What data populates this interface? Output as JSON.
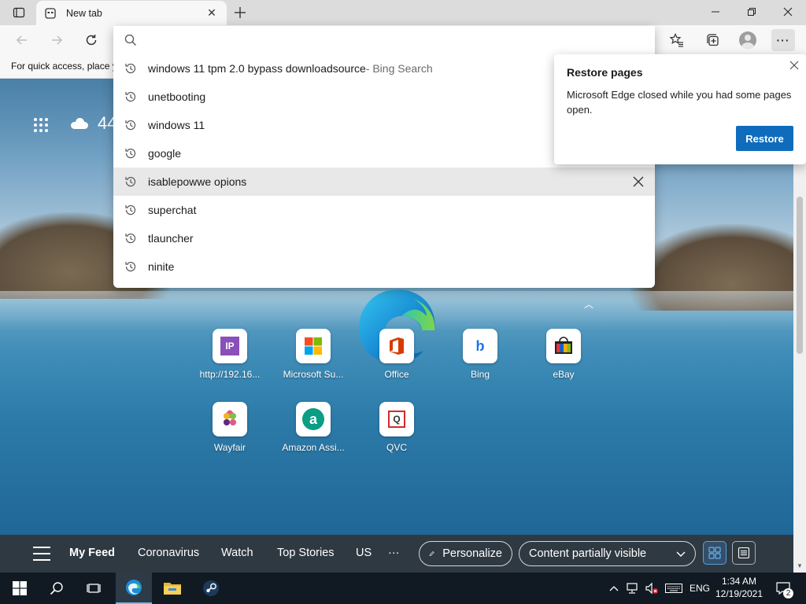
{
  "tab": {
    "title": "New tab"
  },
  "toolbar": {
    "more_label": "···"
  },
  "favorites_bar": {
    "text": "For quick access, place y"
  },
  "weather": {
    "temp": "44"
  },
  "search": {
    "placeholder": ""
  },
  "suggestions": [
    {
      "text": "windows 11 tpm 2.0 bypass downloadsource",
      "suffix": " - Bing Search"
    },
    {
      "text": "unetbooting",
      "suffix": ""
    },
    {
      "text": "windows 11",
      "suffix": ""
    },
    {
      "text": "google",
      "suffix": ""
    },
    {
      "text": "isablepowwe opions",
      "suffix": ""
    },
    {
      "text": "superchat",
      "suffix": ""
    },
    {
      "text": "tlauncher",
      "suffix": ""
    },
    {
      "text": "ninite",
      "suffix": ""
    }
  ],
  "restore_popup": {
    "title": "Restore pages",
    "message": "Microsoft Edge closed while you had some pages open.",
    "button": "Restore"
  },
  "quick_links": [
    {
      "label": "http://192.16...",
      "icon": "ip-icon"
    },
    {
      "label": "Microsoft Su...",
      "icon": "microsoft-icon"
    },
    {
      "label": "Office",
      "icon": "office-icon"
    },
    {
      "label": "Bing",
      "icon": "bing-icon"
    },
    {
      "label": "eBay",
      "icon": "ebay-icon"
    },
    {
      "label": "Wayfair",
      "icon": "wayfair-icon"
    },
    {
      "label": "Amazon Assi...",
      "icon": "amazon-icon"
    },
    {
      "label": "QVC",
      "icon": "qvc-icon"
    }
  ],
  "quick_link_tile_text": {
    "ip": "IP",
    "bing": "b",
    "amazon": "a",
    "qvc": "Q"
  },
  "feed": {
    "items": [
      "My Feed",
      "Coronavirus",
      "Watch",
      "Top Stories",
      "US",
      "···"
    ],
    "personalize": "Personalize",
    "content_visibility": "Content partially visible"
  },
  "taskbar": {
    "language": "ENG",
    "time": "1:34 AM",
    "date": "12/19/2021",
    "notification_count": "2"
  },
  "colors": {
    "accent": "#0f6cbd",
    "feed_bar": "#121e28",
    "taskbar": "#111a22"
  }
}
